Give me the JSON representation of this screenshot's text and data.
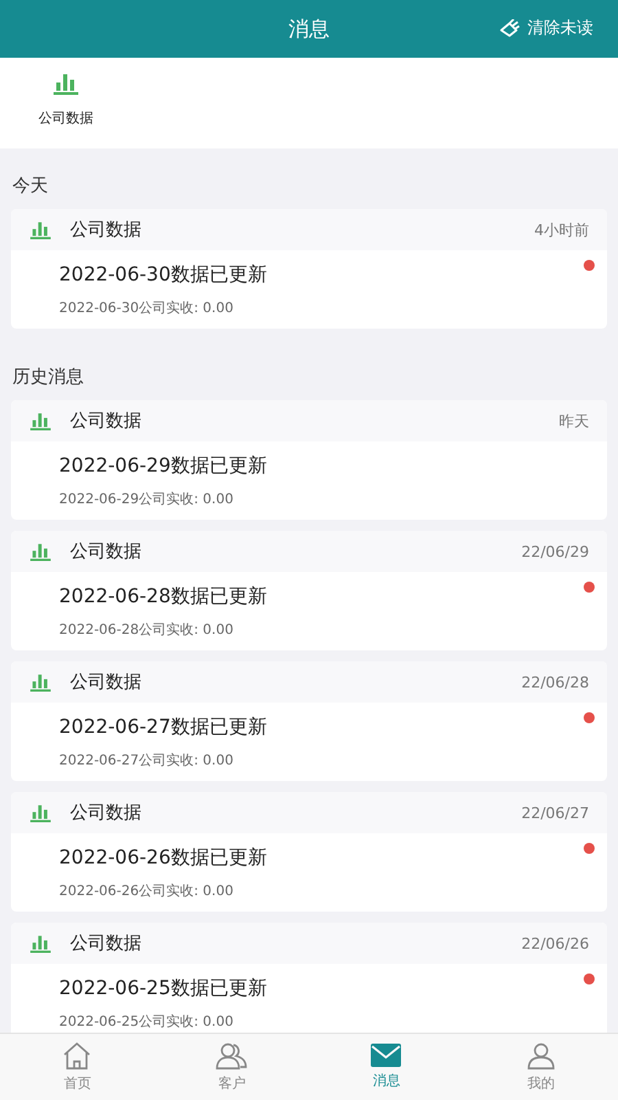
{
  "header": {
    "title": "消息",
    "action": "清除未读"
  },
  "shortcuts": [
    {
      "label": "公司数据"
    }
  ],
  "sections": [
    {
      "title": "今天",
      "messages": [
        {
          "category": "公司数据",
          "time": "4小时前",
          "title": "2022-06-30数据已更新",
          "detail": "2022-06-30公司实收: 0.00",
          "unread": true
        }
      ]
    },
    {
      "title": "历史消息",
      "messages": [
        {
          "category": "公司数据",
          "time": "昨天",
          "title": "2022-06-29数据已更新",
          "detail": "2022-06-29公司实收: 0.00",
          "unread": false
        },
        {
          "category": "公司数据",
          "time": "22/06/29",
          "title": "2022-06-28数据已更新",
          "detail": "2022-06-28公司实收: 0.00",
          "unread": true
        },
        {
          "category": "公司数据",
          "time": "22/06/28",
          "title": "2022-06-27数据已更新",
          "detail": "2022-06-27公司实收: 0.00",
          "unread": true
        },
        {
          "category": "公司数据",
          "time": "22/06/27",
          "title": "2022-06-26数据已更新",
          "detail": "2022-06-26公司实收: 0.00",
          "unread": true
        },
        {
          "category": "公司数据",
          "time": "22/06/26",
          "title": "2022-06-25数据已更新",
          "detail": "2022-06-25公司实收: 0.00",
          "unread": true
        }
      ]
    }
  ],
  "tabbar": [
    {
      "kind": "home",
      "label": "首页",
      "selected": false
    },
    {
      "kind": "customers",
      "label": "客户",
      "selected": false
    },
    {
      "kind": "messages",
      "label": "消息",
      "selected": true
    },
    {
      "kind": "profile",
      "label": "我的",
      "selected": false
    }
  ]
}
